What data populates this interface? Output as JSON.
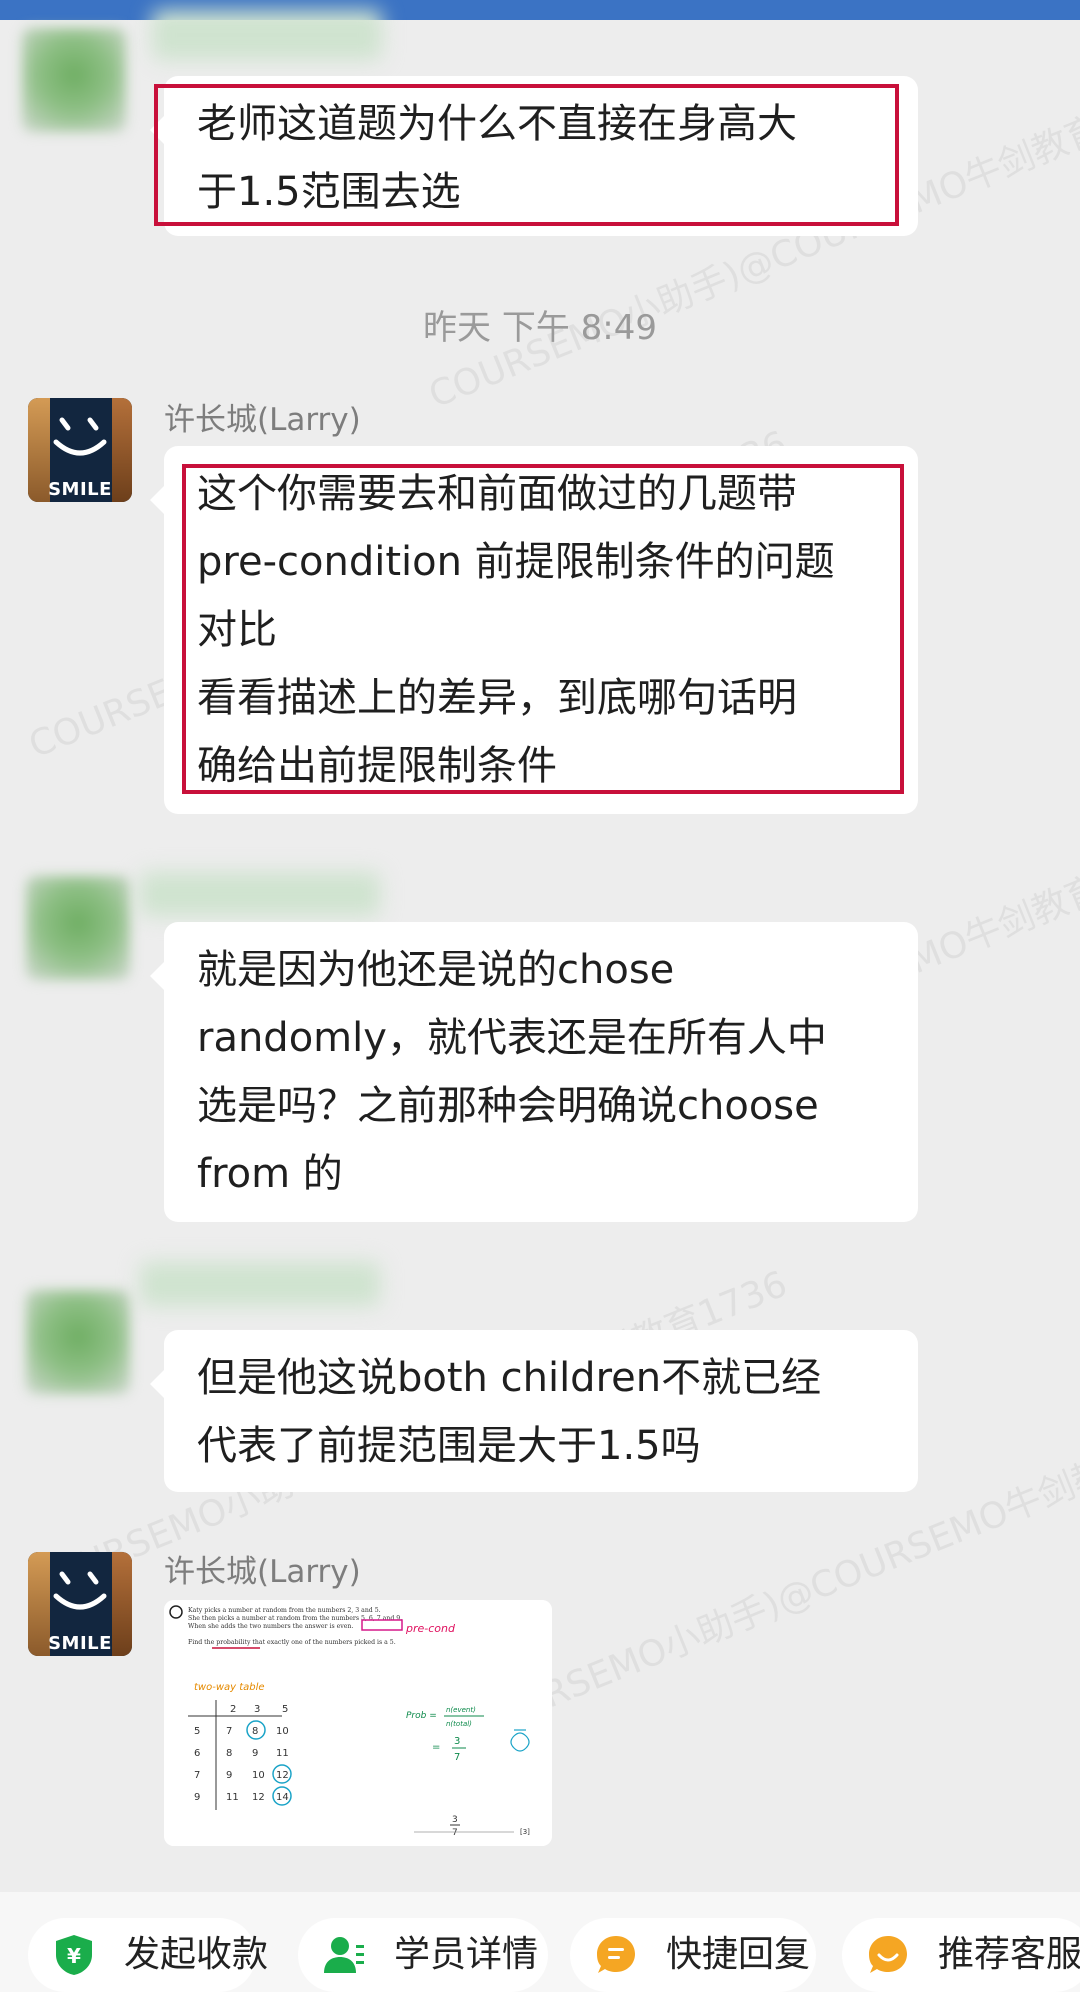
{
  "time_separator": "昨天  下午 8:49",
  "watermark": "COURSEMO小助手)@COURSEMO牛剑教育1736",
  "messages": [
    {
      "sender": "",
      "text": "老师这道题为什么不直接在身高大\n于1.5范围去选",
      "highlighted": true
    },
    {
      "sender": "许长城(Larry)",
      "avatar_text": "SMILE",
      "text": "这个你需要去和前面做过的几题带\npre-condition 前提限制条件的问题\n对比\n看看描述上的差异，到底哪句话明\n确给出前提限制条件",
      "highlighted": true
    },
    {
      "sender": "",
      "text": "就是因为他还是说的chose\nrandomly，就代表还是在所有人中\n选是吗？之前那种会明确说choose\nfrom 的",
      "highlighted": false
    },
    {
      "sender": "",
      "text": "但是他这说both children不就已经\n代表了前提范围是大于1.5吗",
      "highlighted": false
    },
    {
      "sender": "许长城(Larry)",
      "avatar_text": "SMILE",
      "type": "image",
      "image_lines": [
        "Katy picks a number at random from the numbers 2, 3 and 5.",
        "She then picks a number at random from the numbers 5, 6, 7 and 9.",
        "When she adds the two numbers the answer is even.",
        "Find the probability that exactly one of the numbers picked is a 5."
      ],
      "image_handwriting": [
        "pre-cond",
        "two-way table",
        "2",
        "3",
        "5",
        "5",
        "6",
        "7",
        "9",
        "7",
        "8",
        "10",
        "8",
        "9",
        "11",
        "9",
        "10",
        "12",
        "11",
        "12",
        "14",
        "Prob =",
        "n(event)",
        "n(total)",
        "=",
        "3",
        "7",
        "3",
        "7",
        "[3]"
      ]
    }
  ],
  "bottom_actions": [
    {
      "label": "发起收款",
      "icon": "payment-icon",
      "color": "#1aad4b"
    },
    {
      "label": "学员详情",
      "icon": "student-icon",
      "color": "#1aad4b"
    },
    {
      "label": "快捷回复",
      "icon": "quick-reply-icon",
      "color": "#f5a623"
    },
    {
      "label": "推荐客服",
      "icon": "recommend-service-icon",
      "color": "#f5a623"
    }
  ],
  "colors": {
    "background": "#ededed",
    "bubble": "#ffffff",
    "highlight_border": "#c8103a",
    "top_bar": "#3b73c4"
  }
}
